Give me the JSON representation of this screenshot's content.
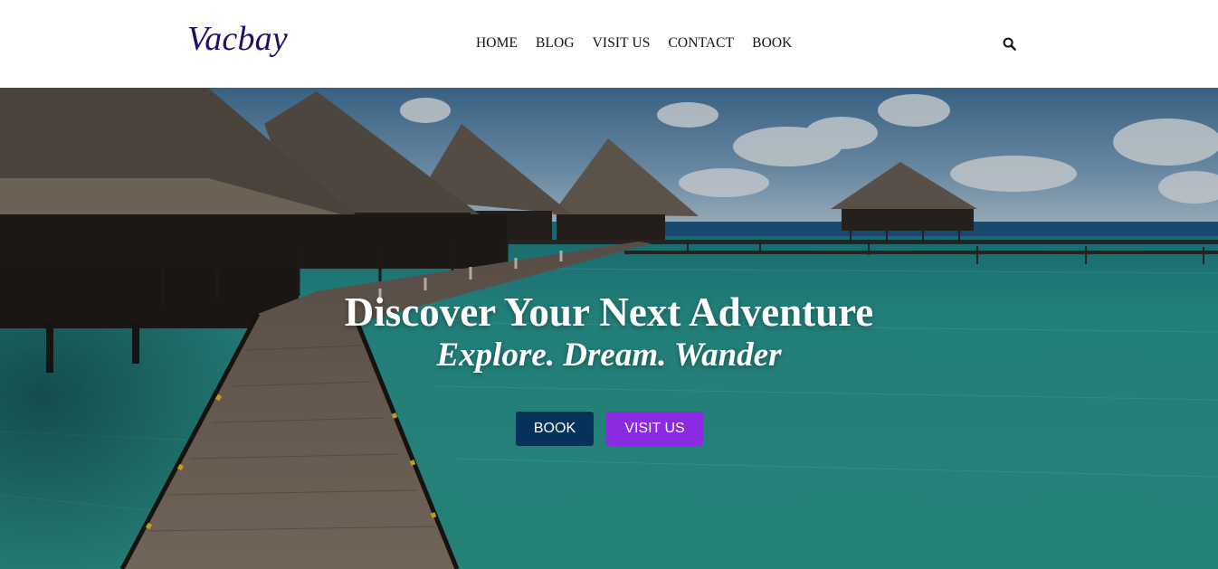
{
  "header": {
    "logo": "Vacbay",
    "nav": [
      {
        "label": "HOME"
      },
      {
        "label": "BLOG"
      },
      {
        "label": "VISIT US"
      },
      {
        "label": "CONTACT"
      },
      {
        "label": "BOOK"
      }
    ],
    "search_icon": "search-icon"
  },
  "hero": {
    "title": "Discover Your Next Adventure",
    "subtitle": "Explore. Dream. Wander",
    "buttons": {
      "book": "BOOK",
      "visit": "VISIT US"
    }
  },
  "colors": {
    "logo": "#1f0f6b",
    "book_button": "#04325a",
    "visit_button": "#8a2be2",
    "sea": "#2e9d96",
    "sky": "#4f7ea8"
  }
}
